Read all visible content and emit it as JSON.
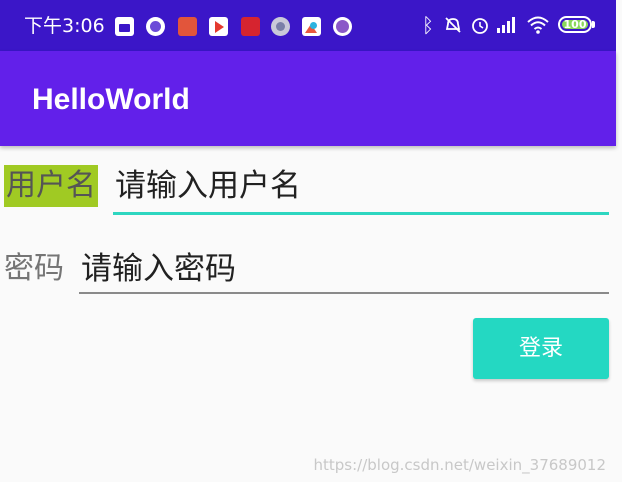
{
  "status_bar": {
    "time": "下午3:06",
    "notification_icons": [
      "mi-store-icon",
      "circle-app-icon",
      "mi-icon",
      "video-icon",
      "shop-icon",
      "circle-app-icon",
      "photo-icon",
      "circle-app-icon"
    ],
    "system_icons": [
      "bluetooth-icon",
      "mute-icon",
      "alarm-icon",
      "signal-icon",
      "wifi-icon"
    ],
    "battery_level": "100",
    "background_color": "#3b16c8"
  },
  "app_bar": {
    "title": "HelloWorld",
    "background_color": "#6220ea"
  },
  "form": {
    "username": {
      "label": "用户名",
      "placeholder": "请输入用户名",
      "label_highlight_color": "#a0ca23",
      "underline_color": "#2ed6c0"
    },
    "password": {
      "label": "密码",
      "placeholder": "请输入密码"
    },
    "login_button": {
      "label": "登录",
      "color": "#24d8c2"
    }
  },
  "watermark": "https://blog.csdn.net/weixin_37689012"
}
